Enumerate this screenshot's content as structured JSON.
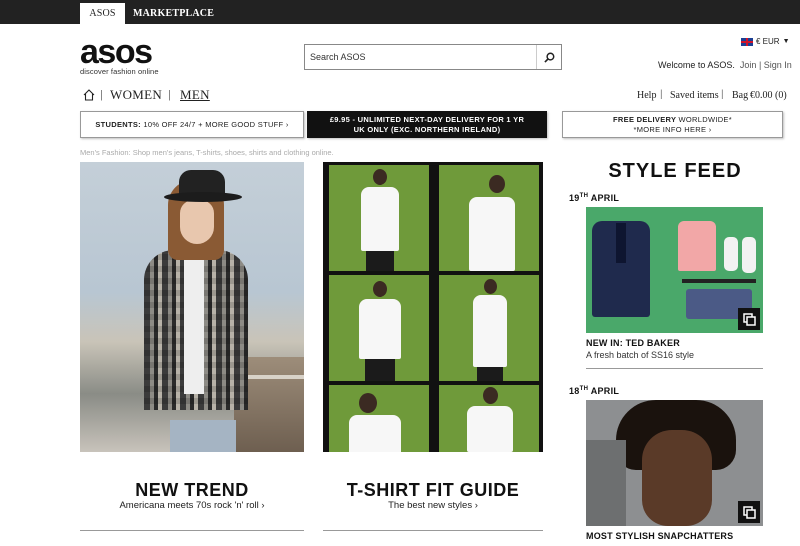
{
  "topbar": {
    "tabs": [
      {
        "label": "ASOS",
        "active": true
      },
      {
        "label": "MARKETPLACE",
        "active": false
      }
    ]
  },
  "logo": {
    "wordmark": "asos",
    "tagline": "discover fashion online"
  },
  "search": {
    "placeholder": "Search ASOS",
    "icon": "search-icon"
  },
  "locale": {
    "currency": "€ EUR",
    "flag": "uk-flag-icon"
  },
  "account": {
    "welcome": "Welcome to ASOS.",
    "join": "Join",
    "sign_in": "Sign In"
  },
  "nav": {
    "women": "WOMEN",
    "men": "MEN",
    "help": "Help",
    "saved": "Saved items",
    "bag": "Bag",
    "bag_total": "€0.00 (0)"
  },
  "promos": [
    {
      "bold": "STUDENTS:",
      "text": "10% OFF 24/7 + MORE GOOD STUFF ›"
    },
    {
      "line1": "£9.95 - UNLIMITED NEXT-DAY DELIVERY FOR 1 YR",
      "line2": "UK ONLY (EXC. NORTHERN IRELAND)"
    },
    {
      "bold": "FREE DELIVERY",
      "light": "WORLDWIDE*",
      "line2": "*MORE INFO HERE ›"
    }
  ],
  "seo_text": "Men's Fashion: Shop men's jeans, T-shirts, shoes, shirts and clothing online.",
  "features": [
    {
      "title": "NEW TREND",
      "subtitle": "Americana meets 70s rock 'n' roll ›"
    },
    {
      "title": "T-SHIRT FIT GUIDE",
      "subtitle": "The best new styles ›"
    }
  ],
  "style_feed": {
    "title": "STYLE FEED",
    "items": [
      {
        "day": "19",
        "suffix": "TH",
        "month": "APRIL",
        "heading": "NEW IN: TED BAKER",
        "subtitle": "A fresh batch of SS16 style"
      },
      {
        "day": "18",
        "suffix": "TH",
        "month": "APRIL",
        "heading": "MOST STYLISH SNAPCHATTERS",
        "subtitle": ""
      }
    ]
  },
  "colors": {
    "topbar": "#222222",
    "promo_dark": "#111111",
    "feed_green": "#4aa86a",
    "grid_green": "#6f9a3a"
  }
}
